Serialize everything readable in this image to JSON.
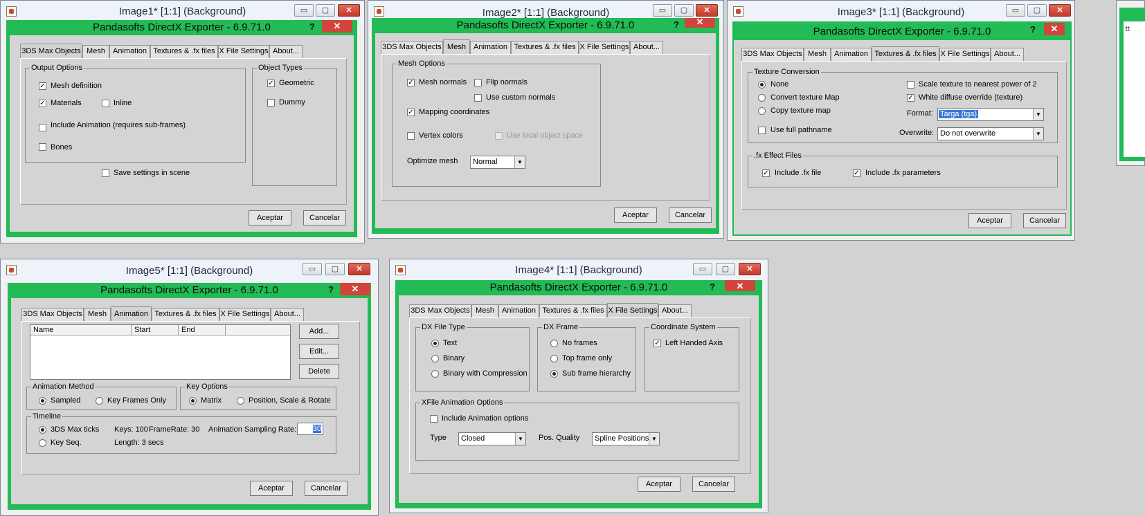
{
  "common": {
    "dialog_title": "Pandasofts DirectX Exporter - 6.9.71.0",
    "help_glyph": "?",
    "close_glyph": "✕",
    "minimize_glyph": "▭",
    "maximize_glyph": "▢",
    "tabs": [
      "3DS Max Objects",
      "Mesh",
      "Animation",
      "Textures & .fx files",
      "X File Settings",
      "About..."
    ],
    "ok": "Aceptar",
    "cancel": "Cancelar",
    "check": "✓",
    "arrow": "▼"
  },
  "windows": {
    "w1": {
      "title": "Image1* [1:1] (Background)",
      "output_options": "Output Options",
      "mesh_definition": "Mesh definition",
      "materials": "Materials",
      "inline": "Inline",
      "include_animation": "Include Animation (requires sub-frames)",
      "bones": "Bones",
      "save_settings": "Save settings in scene",
      "object_types": "Object Types",
      "geometric": "Geometric",
      "dummy": "Dummy"
    },
    "w2": {
      "title": "Image2* [1:1] (Background)",
      "mesh_options": "Mesh Options",
      "mesh_normals": "Mesh normals",
      "flip_normals": "Flip normals",
      "use_custom_normals": "Use custom normals",
      "mapping_coordinates": "Mapping coordinates",
      "vertex_colors": "Vertex colors",
      "use_local_space": "Use local object space",
      "optimize_mesh": "Optimize mesh",
      "optimize_value": "Normal"
    },
    "w3": {
      "title": "Image3* [1:1] (Background)",
      "texture_conversion": "Texture Conversion",
      "none": "None",
      "convert_texture_map": "Convert texture Map",
      "copy_texture_map": "Copy texture map",
      "use_full_pathname": "Use full pathname",
      "scale_texture": "Scale texture to nearest power of 2",
      "white_diffuse": "White diffuse override (texture)",
      "format_label": "Format:",
      "format_value": "Targa (tga)",
      "overwrite_label": "Overwrite:",
      "overwrite_value": "Do not overwrite",
      "fx_effect_files": ".fx Effect Files",
      "include_fx_file": "Include .fx file",
      "include_fx_params": "Include .fx parameters"
    },
    "w5": {
      "title": "Image5* [1:1] (Background)",
      "columns": [
        "Name",
        "Start",
        "End",
        ""
      ],
      "add": "Add...",
      "edit": "Edit...",
      "delete": "Delete",
      "animation_method": "Animation Method",
      "sampled": "Sampled",
      "key_frames_only": "Key Frames Only",
      "key_options": "Key Options",
      "matrix": "Matrix",
      "pos_scale_rotate": "Position, Scale & Rotate",
      "timeline": "Timeline",
      "max_ticks": "3DS Max ticks",
      "key_seq": "Key Seq.",
      "keys": "Keys: 100",
      "framerate": "FrameRate: 30",
      "length": "Length: 3 secs",
      "sampling_rate_label": "Animation Sampling Rate:",
      "sampling_rate_value": "30"
    },
    "w4": {
      "title": "Image4* [1:1] (Background)",
      "dx_file_type": "DX File Type",
      "text": "Text",
      "binary": "Binary",
      "binary_compression": "Binary with Compression",
      "dx_frame": "DX Frame",
      "no_frames": "No frames",
      "top_frame_only": "Top frame only",
      "sub_frame_hierarchy": "Sub frame hierarchy",
      "coordinate_system": "Coordinate System",
      "left_handed_axis": "Left Handed Axis",
      "xfile_anim_options": "XFile Animation Options",
      "include_anim_options": "Include Animation options",
      "type_label": "Type",
      "type_value": "Closed",
      "pos_quality_label": "Pos. Quality",
      "pos_quality_value": "Spline Positions"
    }
  }
}
